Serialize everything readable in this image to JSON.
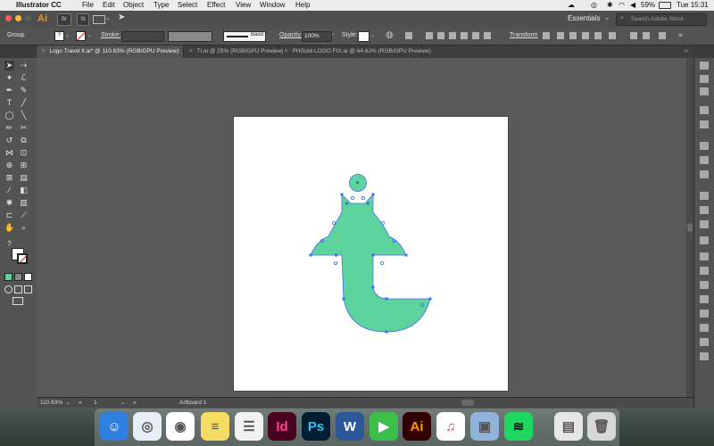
{
  "menubar": {
    "apple_icon": "apple-logo",
    "app_name": "Illustrator CC",
    "items": [
      "File",
      "Edit",
      "Object",
      "Type",
      "Select",
      "Effect",
      "View",
      "Window",
      "Help"
    ],
    "battery": "59%",
    "clock": "Tue 15:31"
  },
  "appbar": {
    "logo": "Ai",
    "bridge_label": "Br",
    "stock_label": "St",
    "workspace": "Essentials",
    "search_placeholder": "Search Adobe Stock"
  },
  "controlbar": {
    "selection_label": "Group",
    "stroke_label": "Stroke:",
    "stroke_profile": "Basic",
    "opacity_label": "Opacity:",
    "opacity_value": "100%",
    "style_label": "Style:",
    "transform_label": "Transform"
  },
  "tabs": [
    {
      "label": "Logo Travel It.ai* @ 110.63% (RGB/GPU Preview)",
      "active": true
    },
    {
      "label": "TI.ai @ 25% (RGB/GPU Preview)",
      "active": false
    },
    {
      "label": "PHGold LOGO FIX.ai @ 64.62% (RGB/GPU Preview)",
      "active": false
    }
  ],
  "status": {
    "zoom": "110.63%",
    "artboard_number": "1",
    "tool_name": "Artboard 1"
  },
  "colors": {
    "shape_fill": "#5dd39e",
    "selection": "#3f6df2",
    "artboard": "#ffffff",
    "canvas": "#595959"
  },
  "dock": [
    {
      "name": "finder-icon",
      "glyph": "☺",
      "bg": "#2f7fe0"
    },
    {
      "name": "safari-icon",
      "glyph": "◎",
      "bg": "#e8eef8"
    },
    {
      "name": "chrome-icon",
      "glyph": "◉",
      "bg": "#ffffff"
    },
    {
      "name": "notes-icon",
      "glyph": "≡",
      "bg": "#f6dc63"
    },
    {
      "name": "reminders-icon",
      "glyph": "☰",
      "bg": "#f2f2f2"
    },
    {
      "name": "indesign-icon",
      "glyph": "Id",
      "bg": "#49021f"
    },
    {
      "name": "photoshop-icon",
      "glyph": "Ps",
      "bg": "#001d34"
    },
    {
      "name": "word-icon",
      "glyph": "W",
      "bg": "#2b5797"
    },
    {
      "name": "facetime-icon",
      "glyph": "▶",
      "bg": "#3bbf4a"
    },
    {
      "name": "illustrator-icon",
      "glyph": "Ai",
      "bg": "#330000"
    },
    {
      "name": "itunes-icon",
      "glyph": "♫",
      "bg": "#ffffff"
    },
    {
      "name": "preview-icon",
      "glyph": "▣",
      "bg": "#8fb3d9"
    },
    {
      "name": "spotify-icon",
      "glyph": "≋",
      "bg": "#1ed760"
    },
    {
      "name": "documents-folder-icon",
      "glyph": "▤",
      "bg": "#e6e6e6"
    },
    {
      "name": "trash-icon",
      "glyph": "🗑",
      "bg": "#d8d8d8"
    }
  ]
}
